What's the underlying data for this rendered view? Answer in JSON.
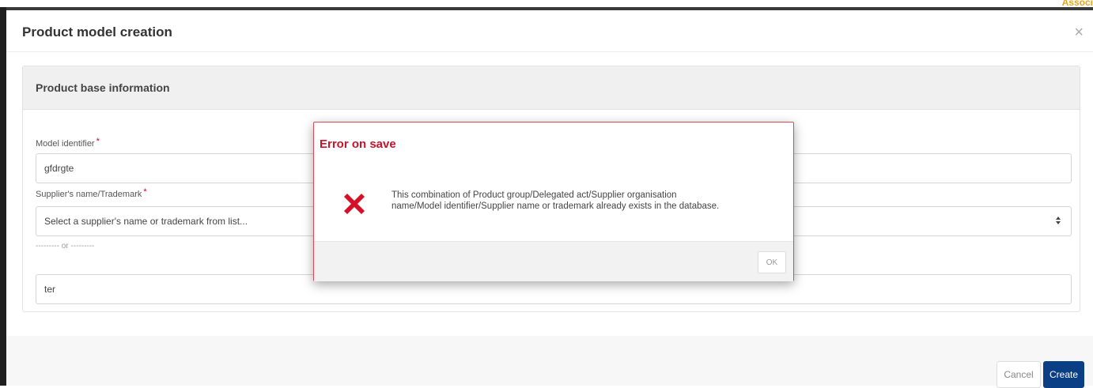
{
  "corner_text": "Associ",
  "modal": {
    "title": "Product model creation",
    "close_icon": "close-icon"
  },
  "panel": {
    "title": "Product base information",
    "model_identifier": {
      "label": "Model identifier",
      "required": "*",
      "value": "gfdrgte"
    },
    "supplier": {
      "label": "Supplier's name/Trademark",
      "required": "*",
      "selected": "Select a supplier's name or trademark from list...",
      "caret_icon": "sort-caret-icon"
    },
    "or_separator": "--------- or ---------",
    "manual_entry": {
      "value": "ter"
    }
  },
  "footer": {
    "cancel_label": "Cancel",
    "create_label": "Create",
    "create_color": "#0a3f86"
  },
  "error_dialog": {
    "title": "Error on save",
    "title_color": "#c7132c",
    "icon": "error-x-icon",
    "message_line1": "This combination of Product group/Delegated act/Supplier organisation",
    "message_line2": "name/Model identifier/Supplier name or trademark already exists in the database.",
    "ok_label": "OK"
  }
}
